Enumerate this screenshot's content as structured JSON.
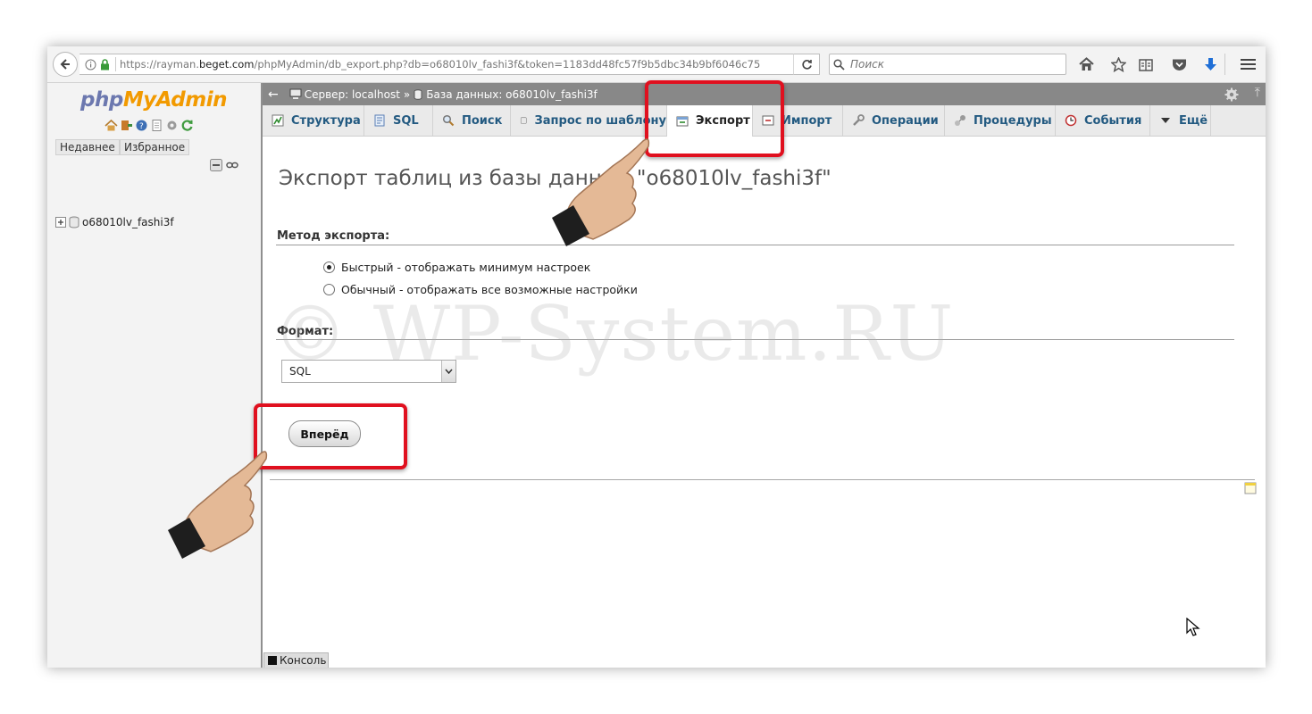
{
  "browser": {
    "url_prefix": "https://rayman.",
    "url_domain": "beget.com",
    "url_suffix": "/phpMyAdmin/db_export.php?db=o68010lv_fashi3f&token=1183dd48fc57f9b5dbc34b9bf6046c75",
    "search_placeholder": "Поиск"
  },
  "sidebar": {
    "logo_php": "php",
    "logo_myadmin": "MyAdmin",
    "tab_recent": "Недавнее",
    "tab_favorites": "Избранное",
    "database": "o68010lv_fashi3f"
  },
  "breadcrumb": {
    "server": "Сервер: localhost",
    "separator": "»",
    "database": "База данных: o68010lv_fashi3f"
  },
  "tabs": [
    {
      "label": "Структура",
      "icon": "structure-icon"
    },
    {
      "label": "SQL",
      "icon": "sql-icon"
    },
    {
      "label": "Поиск",
      "icon": "search-icon"
    },
    {
      "label": "Запрос по шаблону",
      "icon": "query-icon"
    },
    {
      "label": "Экспорт",
      "icon": "export-icon",
      "active": true
    },
    {
      "label": "Импорт",
      "icon": "import-icon"
    },
    {
      "label": "Операции",
      "icon": "wrench-icon"
    },
    {
      "label": "Процедуры",
      "icon": "routines-icon"
    },
    {
      "label": "События",
      "icon": "clock-icon"
    },
    {
      "label": "Ещё",
      "icon": "triangle-down-icon"
    }
  ],
  "main": {
    "title": "Экспорт таблиц из базы данных \"o68010lv_fashi3f\"",
    "method_label": "Метод экспорта:",
    "method_quick": "Быстрый - отображать минимум настроек",
    "method_custom": "Обычный - отображать все возможные настройки",
    "format_label": "Формат:",
    "format_value": "SQL",
    "go_button": "Вперёд",
    "console": "Консоль"
  },
  "watermark": "© WP-System.RU",
  "colors": {
    "highlight": "#e0101f",
    "tab_text": "#235a81",
    "breadcrumb_bg": "#888888",
    "logo_php": "#6c78af",
    "logo_myadmin": "#f29a00"
  }
}
